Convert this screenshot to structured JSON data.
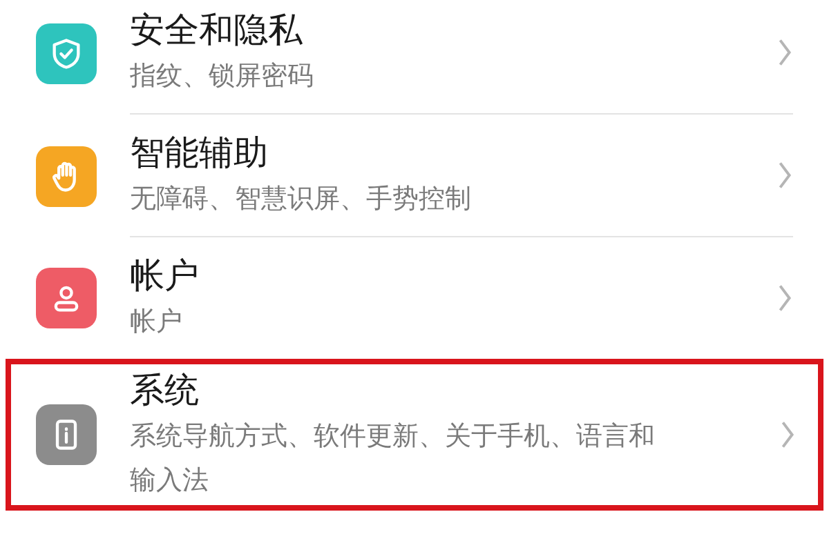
{
  "settings_items": [
    {
      "title": "安全和隐私",
      "subtitle": "指纹、锁屏密码",
      "color": "#2ec4bd",
      "highlighted": false
    },
    {
      "title": "智能辅助",
      "subtitle": "无障碍、智慧识屏、手势控制",
      "color": "#f5a623",
      "highlighted": false
    },
    {
      "title": "帐户",
      "subtitle": "帐户",
      "color": "#ee5c66",
      "highlighted": false
    },
    {
      "title": "系统",
      "subtitle": "系统导航方式、软件更新、关于手机、语言和输入法",
      "color": "#8c8c8c",
      "highlighted": true
    }
  ]
}
